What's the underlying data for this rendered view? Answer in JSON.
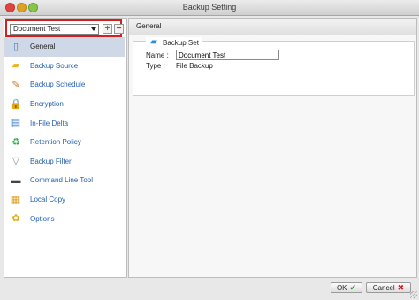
{
  "window": {
    "title": "Backup Setting"
  },
  "backup_set_selector": {
    "value": "Document Test",
    "add_label": "+",
    "remove_label": "−"
  },
  "nav": {
    "items": [
      {
        "label": "General",
        "icon": "general-icon",
        "glyph": "▯",
        "color": "#4a78b8",
        "selected": true
      },
      {
        "label": "Backup Source",
        "icon": "folder-icon",
        "glyph": "▰",
        "color": "#e8b520",
        "selected": false
      },
      {
        "label": "Backup Schedule",
        "icon": "schedule-icon",
        "glyph": "✎",
        "color": "#c47a20",
        "selected": false
      },
      {
        "label": "Encryption",
        "icon": "lock-icon",
        "glyph": "🔒",
        "color": "#d9a520",
        "selected": false
      },
      {
        "label": "In-File Delta",
        "icon": "document-icon",
        "glyph": "▤",
        "color": "#3a7fd0",
        "selected": false
      },
      {
        "label": "Retention Policy",
        "icon": "recycle-icon",
        "glyph": "♻",
        "color": "#2ea84a",
        "selected": false
      },
      {
        "label": "Backup Filter",
        "icon": "filter-icon",
        "glyph": "▽",
        "color": "#8a8a8a",
        "selected": false
      },
      {
        "label": "Command Line Tool",
        "icon": "terminal-icon",
        "glyph": "▬",
        "color": "#444444",
        "selected": false
      },
      {
        "label": "Local Copy",
        "icon": "local-copy-icon",
        "glyph": "▦",
        "color": "#e0a020",
        "selected": false
      },
      {
        "label": "Options",
        "icon": "options-icon",
        "glyph": "✿",
        "color": "#e0b020",
        "selected": false
      }
    ]
  },
  "panel": {
    "header": "General",
    "group_title": "Backup Set",
    "name_label": "Name :",
    "name_value": "Document Test",
    "type_label": "Type :",
    "type_value": "File Backup"
  },
  "buttons": {
    "ok": "OK",
    "cancel": "Cancel"
  }
}
